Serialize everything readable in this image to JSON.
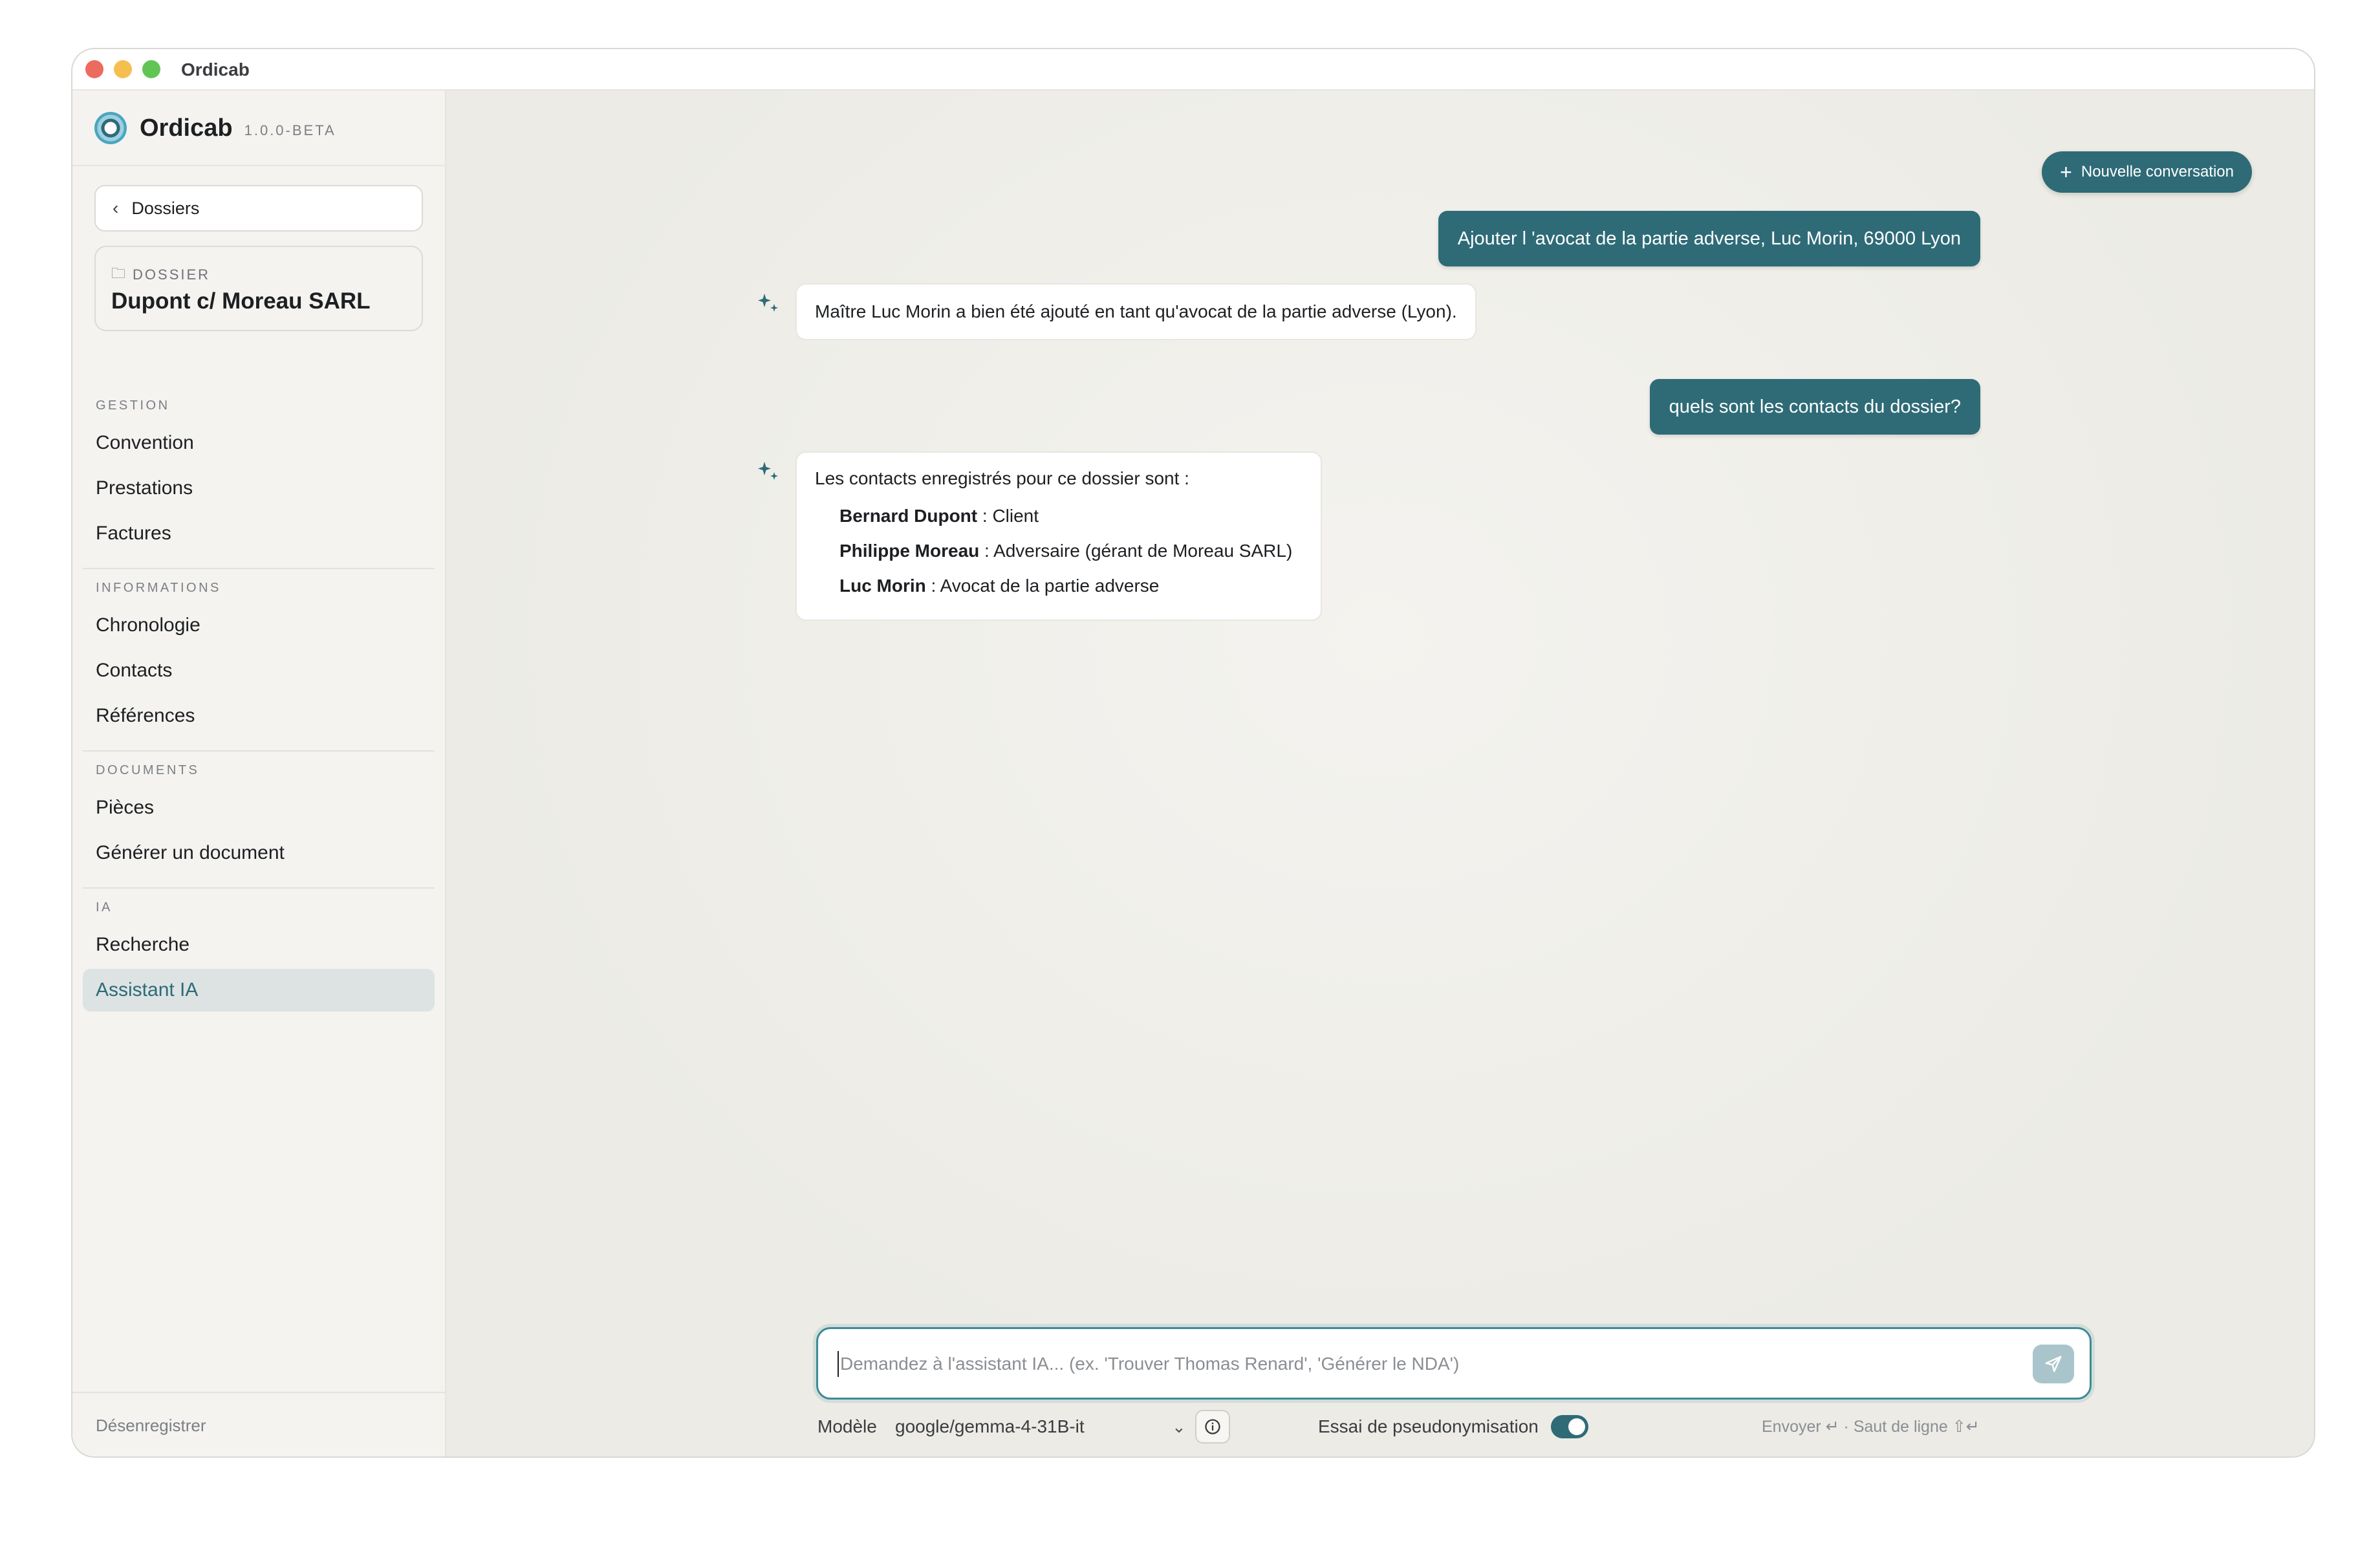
{
  "window": {
    "title": "Ordicab"
  },
  "brand": {
    "name": "Ordicab",
    "version": "1.0.0-BETA"
  },
  "sidebar": {
    "back_label": "Dossiers",
    "dossier_label": "DOSSIER",
    "dossier_name": "Dupont c/ Moreau SARL",
    "sections": [
      {
        "label": "GESTION",
        "items": [
          "Convention",
          "Prestations",
          "Factures"
        ]
      },
      {
        "label": "INFORMATIONS",
        "items": [
          "Chronologie",
          "Contacts",
          "Références"
        ]
      },
      {
        "label": "DOCUMENTS",
        "items": [
          "Pièces",
          "Générer un document"
        ]
      },
      {
        "label": "IA",
        "items": [
          "Recherche",
          "Assistant IA"
        ]
      }
    ],
    "active_item": "Assistant IA",
    "footer": "Désenregistrer"
  },
  "header": {
    "new_conversation": "Nouvelle conversation"
  },
  "conversation": {
    "user_1": "Ajouter l 'avocat de la partie adverse, Luc Morin, 69000 Lyon",
    "bot_1": "Maître Luc Morin a bien été ajouté en tant qu'avocat de la partie adverse (Lyon).",
    "user_2": "quels sont les contacts du dossier?",
    "bot_2_intro": "Les contacts enregistrés pour ce dossier sont :",
    "bot_2_contacts": [
      {
        "name": "Bernard Dupont",
        "desc": " : Client"
      },
      {
        "name": "Philippe Moreau",
        "desc": " : Adversaire (gérant de Moreau SARL)"
      },
      {
        "name": "Luc Morin",
        "desc": " : Avocat de la partie adverse"
      }
    ]
  },
  "composer": {
    "placeholder": "Demandez à l'assistant IA... (ex. 'Trouver Thomas Renard', 'Générer le NDA')",
    "model_label": "Modèle",
    "model_value": "google/gemma-4-31B-it",
    "pseudonymisation_label": "Essai de pseudonymisation",
    "pseudonymisation_on": true,
    "shortcuts": "Envoyer ↵ · Saut de ligne ⇧↵"
  },
  "colors": {
    "accent": "#2e6b77",
    "background": "#f1efea"
  },
  "icons": [
    "chevron-left-icon",
    "folder-icon",
    "plus-icon",
    "sparkle-icon",
    "send-icon",
    "chevron-down-icon",
    "info-icon"
  ]
}
